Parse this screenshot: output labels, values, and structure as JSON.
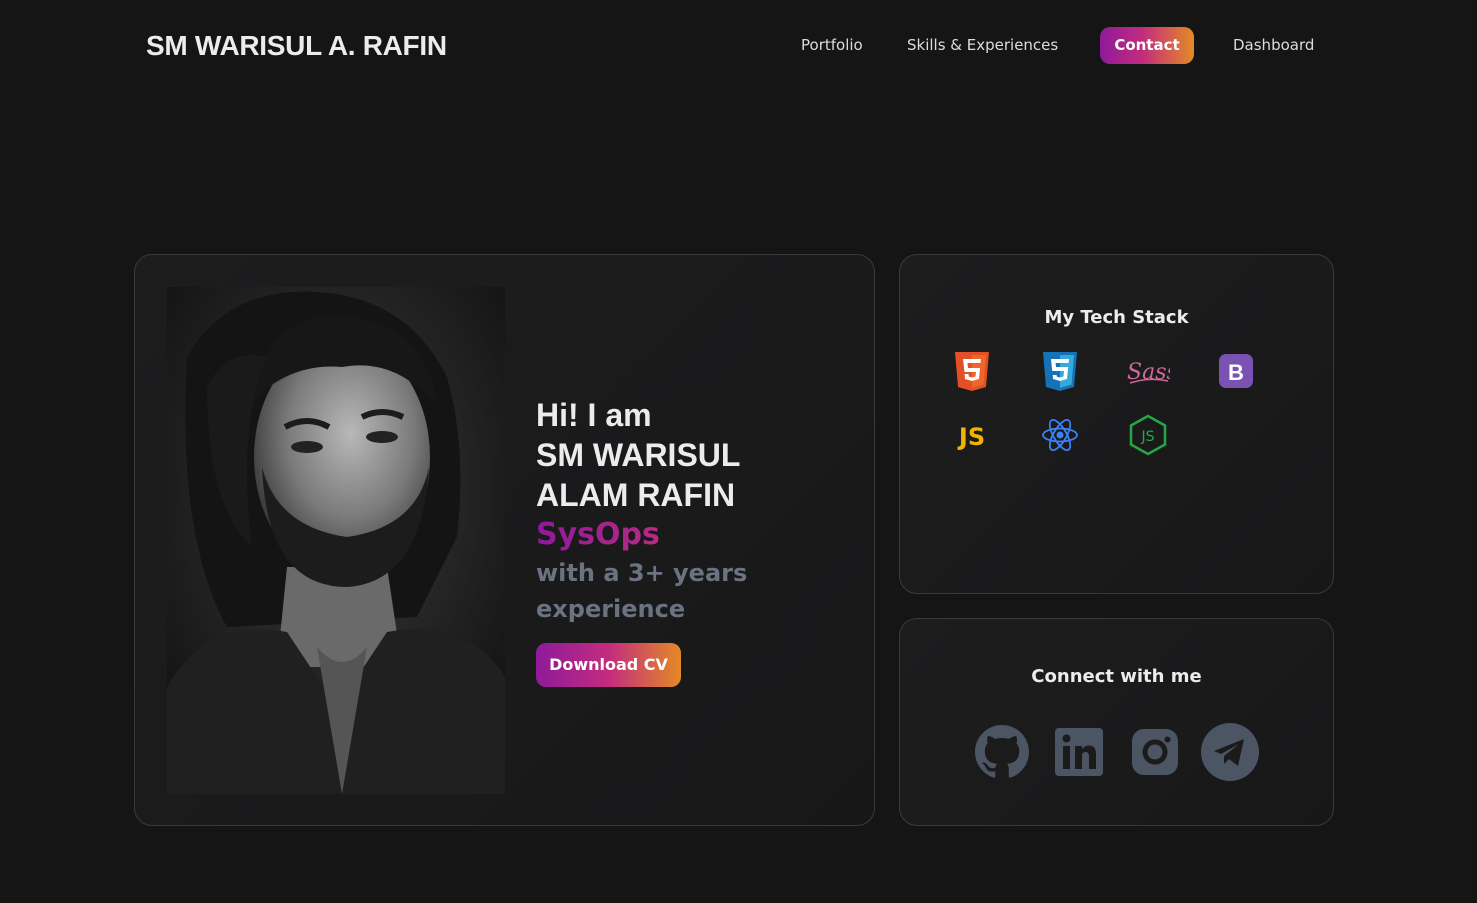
{
  "header": {
    "brand": "SM WARISUL A. RAFIN",
    "nav": {
      "portfolio": "Portfolio",
      "skills": "Skills & Experiences",
      "contact": "Contact",
      "dashboard": "Dashboard"
    }
  },
  "hero": {
    "greeting": "Hi! I am",
    "name_line1": "SM WARISUL",
    "name_line2": "ALAM RAFIN",
    "role": "SysOps",
    "experience_line1": "with a 3+ years",
    "experience_line2": "experience",
    "cv_button": "Download CV",
    "portrait": "portrait-photo"
  },
  "tech_stack": {
    "title": "My Tech Stack",
    "icons": [
      "html5-icon",
      "css3-icon",
      "sass-icon",
      "bootstrap-icon",
      "javascript-icon",
      "react-icon",
      "nodejs-icon"
    ],
    "js_label": "JS"
  },
  "connect": {
    "title": "Connect with me",
    "icons": [
      "github-icon",
      "linkedin-icon",
      "instagram-icon",
      "telegram-icon"
    ]
  },
  "colors": {
    "background": "#151515",
    "accent_start": "#8e1a9a",
    "accent_mid": "#c32c7e",
    "accent_end": "#e48a25",
    "muted_text": "#6b7280",
    "social_icon": "#4b5563"
  }
}
